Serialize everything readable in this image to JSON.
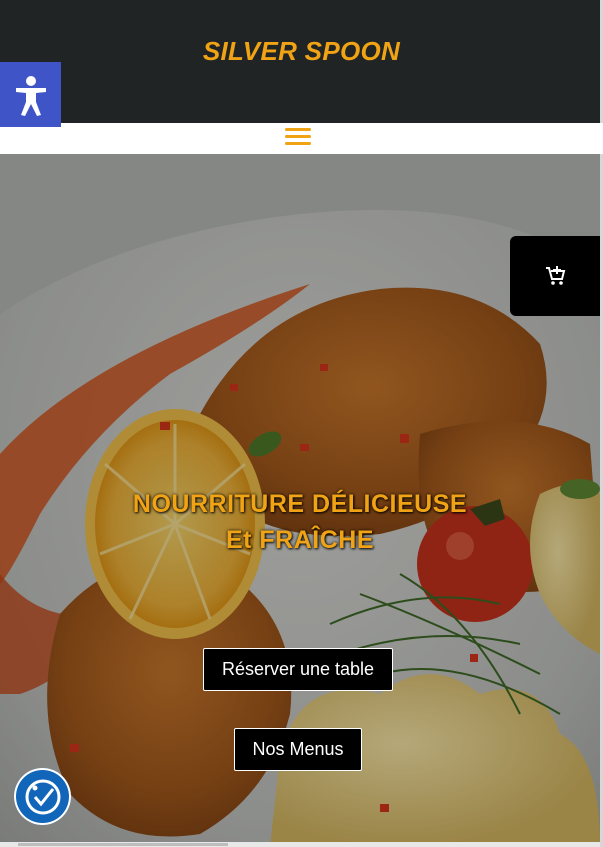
{
  "header": {
    "brand": "SILVER SPOON",
    "background_color": "#212425",
    "brand_color": "#f0a314"
  },
  "nav": {
    "menu_icon": "hamburger-menu-icon"
  },
  "accessibility_toolbar": {
    "icon": "accessibility-person-icon",
    "color": "#3f55c7"
  },
  "cart": {
    "icon": "add-to-cart-icon"
  },
  "hero": {
    "title_line1": "NOURRITURE DÉLICIEUSE",
    "title_line2": "Et FRAÎCHE",
    "reserve_button": "Réserver une table",
    "menus_button": "Nos Menus",
    "image": "fried-schnitzel-lemon-tomato-mashed-potatoes-photo"
  },
  "accessibility_widget": {
    "icon": "accessibility-check-icon",
    "color": "#1266b9"
  }
}
